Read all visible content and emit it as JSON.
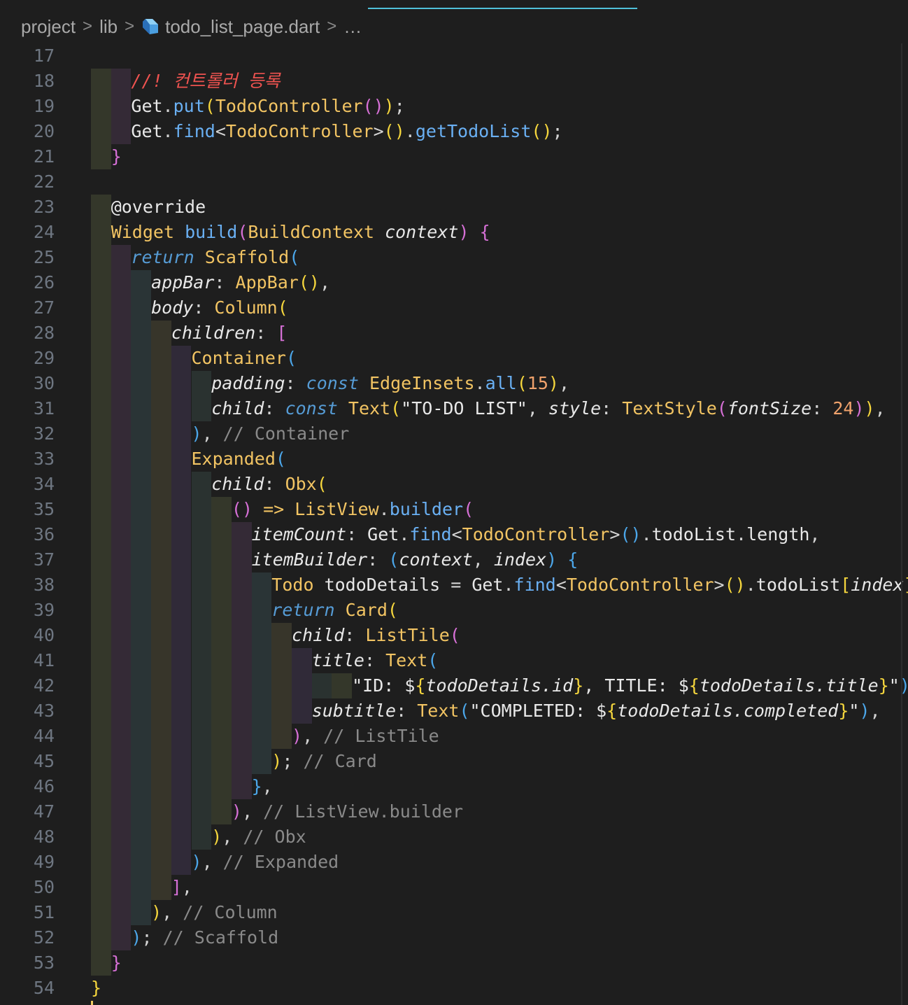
{
  "breadcrumb": {
    "items": [
      "project",
      "lib",
      "todo_list_page.dart",
      "…"
    ],
    "separator": ">"
  },
  "icons": {
    "file": "dart-icon"
  },
  "colors": {
    "background": "#1e1e1e",
    "line_number": "#6e7681",
    "accent": "#4fc1d9",
    "keyword": "#569cd6",
    "type": "#f2c463",
    "function": "#6ab0f3",
    "comment": "#8a8a8a",
    "number": "#f0a26c",
    "bracket_gold": "#f5d63d",
    "bracket_purple": "#d670d6",
    "bracket_blue": "#4ca7ea",
    "korean_comment": "#ef5350"
  },
  "lines": [
    {
      "n": "17",
      "indent": 0,
      "tokens": []
    },
    {
      "n": "18",
      "indent": 2,
      "tokens": [
        [
          "ko",
          "//! 컨트롤러 등록"
        ]
      ]
    },
    {
      "n": "19",
      "indent": 2,
      "tokens": [
        [
          "id",
          "Get"
        ],
        [
          "pu",
          "."
        ],
        [
          "fn",
          "put"
        ],
        [
          "b1",
          "("
        ],
        [
          "ty",
          "TodoController"
        ],
        [
          "b2",
          "()"
        ],
        [
          "b1",
          ")"
        ],
        [
          "pu",
          ";"
        ]
      ]
    },
    {
      "n": "20",
      "indent": 2,
      "tokens": [
        [
          "id",
          "Get"
        ],
        [
          "pu",
          "."
        ],
        [
          "fn",
          "find"
        ],
        [
          "pu",
          "<"
        ],
        [
          "ty",
          "TodoController"
        ],
        [
          "pu",
          ">"
        ],
        [
          "b1",
          "()"
        ],
        [
          "pu",
          "."
        ],
        [
          "fn",
          "getTodoList"
        ],
        [
          "b1",
          "()"
        ],
        [
          "pu",
          ";"
        ]
      ]
    },
    {
      "n": "21",
      "indent": 1,
      "tokens": [
        [
          "b2",
          "}"
        ]
      ]
    },
    {
      "n": "22",
      "indent": 0,
      "tokens": []
    },
    {
      "n": "23",
      "indent": 1,
      "tokens": [
        [
          "ann",
          "@override"
        ]
      ]
    },
    {
      "n": "24",
      "indent": 1,
      "tokens": [
        [
          "ty",
          "Widget"
        ],
        [
          "pu",
          " "
        ],
        [
          "fn",
          "build"
        ],
        [
          "b2",
          "("
        ],
        [
          "ty",
          "BuildContext"
        ],
        [
          "pu",
          " "
        ],
        [
          "prm",
          "context"
        ],
        [
          "b2",
          ")"
        ],
        [
          "pu",
          " "
        ],
        [
          "b2",
          "{"
        ]
      ]
    },
    {
      "n": "25",
      "indent": 2,
      "tokens": [
        [
          "ret",
          "return"
        ],
        [
          "pu",
          " "
        ],
        [
          "ty",
          "Scaffold"
        ],
        [
          "b3",
          "("
        ]
      ]
    },
    {
      "n": "26",
      "indent": 3,
      "tokens": [
        [
          "prm",
          "appBar"
        ],
        [
          "pu",
          ": "
        ],
        [
          "ty",
          "AppBar"
        ],
        [
          "b1",
          "()"
        ],
        [
          "pu",
          ","
        ]
      ]
    },
    {
      "n": "27",
      "indent": 3,
      "tokens": [
        [
          "prm",
          "body"
        ],
        [
          "pu",
          ": "
        ],
        [
          "ty",
          "Column"
        ],
        [
          "b1",
          "("
        ]
      ]
    },
    {
      "n": "28",
      "indent": 4,
      "tokens": [
        [
          "prm",
          "children"
        ],
        [
          "pu",
          ": "
        ],
        [
          "b2",
          "["
        ]
      ]
    },
    {
      "n": "29",
      "indent": 5,
      "tokens": [
        [
          "ty",
          "Container"
        ],
        [
          "b3",
          "("
        ]
      ]
    },
    {
      "n": "30",
      "indent": 6,
      "tokens": [
        [
          "prm",
          "padding"
        ],
        [
          "pu",
          ": "
        ],
        [
          "kw",
          "const"
        ],
        [
          "pu",
          " "
        ],
        [
          "ty",
          "EdgeInsets"
        ],
        [
          "pu",
          "."
        ],
        [
          "fn",
          "all"
        ],
        [
          "b1",
          "("
        ],
        [
          "num",
          "15"
        ],
        [
          "b1",
          ")"
        ],
        [
          "pu",
          ","
        ]
      ]
    },
    {
      "n": "31",
      "indent": 6,
      "tokens": [
        [
          "prm",
          "child"
        ],
        [
          "pu",
          ": "
        ],
        [
          "kw",
          "const"
        ],
        [
          "pu",
          " "
        ],
        [
          "ty",
          "Text"
        ],
        [
          "b1",
          "("
        ],
        [
          "str",
          "\"TO-DO LIST\""
        ],
        [
          "pu",
          ", "
        ],
        [
          "prm",
          "style"
        ],
        [
          "pu",
          ": "
        ],
        [
          "ty",
          "TextStyle"
        ],
        [
          "b2",
          "("
        ],
        [
          "prm",
          "fontSize"
        ],
        [
          "pu",
          ": "
        ],
        [
          "num",
          "24"
        ],
        [
          "b2",
          ")"
        ],
        [
          "b1",
          ")"
        ],
        [
          "pu",
          ","
        ]
      ]
    },
    {
      "n": "32",
      "indent": 5,
      "tokens": [
        [
          "b3",
          ")"
        ],
        [
          "pu",
          ", "
        ],
        [
          "cm",
          "// Container"
        ]
      ]
    },
    {
      "n": "33",
      "indent": 5,
      "tokens": [
        [
          "ty",
          "Expanded"
        ],
        [
          "b3",
          "("
        ]
      ]
    },
    {
      "n": "34",
      "indent": 6,
      "tokens": [
        [
          "prm",
          "child"
        ],
        [
          "pu",
          ": "
        ],
        [
          "ty",
          "Obx"
        ],
        [
          "b1",
          "("
        ]
      ]
    },
    {
      "n": "35",
      "indent": 7,
      "tokens": [
        [
          "b2",
          "()"
        ],
        [
          "pu",
          " "
        ],
        [
          "ty",
          "=>"
        ],
        [
          "pu",
          " "
        ],
        [
          "ty",
          "ListView"
        ],
        [
          "pu",
          "."
        ],
        [
          "fn",
          "builder"
        ],
        [
          "b2",
          "("
        ]
      ]
    },
    {
      "n": "36",
      "indent": 8,
      "tokens": [
        [
          "prm",
          "itemCount"
        ],
        [
          "pu",
          ": "
        ],
        [
          "id",
          "Get"
        ],
        [
          "pu",
          "."
        ],
        [
          "fn",
          "find"
        ],
        [
          "pu",
          "<"
        ],
        [
          "ty",
          "TodoController"
        ],
        [
          "pu",
          ">"
        ],
        [
          "b3",
          "()"
        ],
        [
          "pu",
          "."
        ],
        [
          "id",
          "todoList"
        ],
        [
          "pu",
          "."
        ],
        [
          "id",
          "length"
        ],
        [
          "pu",
          ","
        ]
      ]
    },
    {
      "n": "37",
      "indent": 8,
      "tokens": [
        [
          "prm",
          "itemBuilder"
        ],
        [
          "pu",
          ": "
        ],
        [
          "b3",
          "("
        ],
        [
          "prm",
          "context"
        ],
        [
          "pu",
          ", "
        ],
        [
          "prm",
          "index"
        ],
        [
          "b3",
          ")"
        ],
        [
          "pu",
          " "
        ],
        [
          "b3",
          "{"
        ]
      ]
    },
    {
      "n": "38",
      "indent": 9,
      "tokens": [
        [
          "ty",
          "Todo"
        ],
        [
          "pu",
          " "
        ],
        [
          "id",
          "todoDetails"
        ],
        [
          "pu",
          " = "
        ],
        [
          "id",
          "Get"
        ],
        [
          "pu",
          "."
        ],
        [
          "fn",
          "find"
        ],
        [
          "pu",
          "<"
        ],
        [
          "ty",
          "TodoController"
        ],
        [
          "pu",
          ">"
        ],
        [
          "b1",
          "()"
        ],
        [
          "pu",
          "."
        ],
        [
          "id",
          "todoList"
        ],
        [
          "b1",
          "["
        ],
        [
          "prm",
          "index"
        ],
        [
          "b1",
          "]"
        ],
        [
          "pu",
          ";"
        ]
      ]
    },
    {
      "n": "39",
      "indent": 9,
      "tokens": [
        [
          "ret",
          "return"
        ],
        [
          "pu",
          " "
        ],
        [
          "ty",
          "Card"
        ],
        [
          "b1",
          "("
        ]
      ]
    },
    {
      "n": "40",
      "indent": 10,
      "tokens": [
        [
          "prm",
          "child"
        ],
        [
          "pu",
          ": "
        ],
        [
          "ty",
          "ListTile"
        ],
        [
          "b2",
          "("
        ]
      ]
    },
    {
      "n": "41",
      "indent": 11,
      "tokens": [
        [
          "prm",
          "title"
        ],
        [
          "pu",
          ": "
        ],
        [
          "ty",
          "Text"
        ],
        [
          "b3",
          "("
        ]
      ]
    },
    {
      "n": "42",
      "indent": 13,
      "tokens": [
        [
          "str",
          "\"ID: $"
        ],
        [
          "b1",
          "{"
        ],
        [
          "prm",
          "todoDetails.id"
        ],
        [
          "b1",
          "}"
        ],
        [
          "str",
          ", TITLE: $"
        ],
        [
          "b1",
          "{"
        ],
        [
          "prm",
          "todoDetails.title"
        ],
        [
          "b1",
          "}"
        ],
        [
          "str",
          "\""
        ],
        [
          "b3",
          ")"
        ],
        [
          "pu",
          ","
        ]
      ]
    },
    {
      "n": "43",
      "indent": 11,
      "tokens": [
        [
          "prm",
          "subtitle"
        ],
        [
          "pu",
          ": "
        ],
        [
          "ty",
          "Text"
        ],
        [
          "b3",
          "("
        ],
        [
          "str",
          "\"COMPLETED: $"
        ],
        [
          "b1",
          "{"
        ],
        [
          "prm",
          "todoDetails.completed"
        ],
        [
          "b1",
          "}"
        ],
        [
          "str",
          "\""
        ],
        [
          "b3",
          ")"
        ],
        [
          "pu",
          ","
        ]
      ]
    },
    {
      "n": "44",
      "indent": 10,
      "tokens": [
        [
          "b2",
          ")"
        ],
        [
          "pu",
          ", "
        ],
        [
          "cm",
          "// ListTile"
        ]
      ]
    },
    {
      "n": "45",
      "indent": 9,
      "tokens": [
        [
          "b1",
          ")"
        ],
        [
          "pu",
          "; "
        ],
        [
          "cm",
          "// Card"
        ]
      ]
    },
    {
      "n": "46",
      "indent": 8,
      "tokens": [
        [
          "b3",
          "}"
        ],
        [
          "pu",
          ","
        ]
      ]
    },
    {
      "n": "47",
      "indent": 7,
      "tokens": [
        [
          "b2",
          ")"
        ],
        [
          "pu",
          ", "
        ],
        [
          "cm",
          "// ListView.builder"
        ]
      ]
    },
    {
      "n": "48",
      "indent": 6,
      "tokens": [
        [
          "b1",
          ")"
        ],
        [
          "pu",
          ", "
        ],
        [
          "cm",
          "// Obx"
        ]
      ]
    },
    {
      "n": "49",
      "indent": 5,
      "tokens": [
        [
          "b3",
          ")"
        ],
        [
          "pu",
          ", "
        ],
        [
          "cm",
          "// Expanded"
        ]
      ]
    },
    {
      "n": "50",
      "indent": 4,
      "tokens": [
        [
          "b2",
          "]"
        ],
        [
          "pu",
          ","
        ]
      ]
    },
    {
      "n": "51",
      "indent": 3,
      "tokens": [
        [
          "b1",
          ")"
        ],
        [
          "pu",
          ", "
        ],
        [
          "cm",
          "// Column"
        ]
      ]
    },
    {
      "n": "52",
      "indent": 2,
      "tokens": [
        [
          "b3",
          ")"
        ],
        [
          "pu",
          "; "
        ],
        [
          "cm",
          "// Scaffold"
        ]
      ]
    },
    {
      "n": "53",
      "indent": 1,
      "tokens": [
        [
          "b2",
          "}"
        ]
      ]
    },
    {
      "n": "54",
      "indent": 0,
      "tokens": [
        [
          "b1",
          "}"
        ]
      ]
    }
  ]
}
